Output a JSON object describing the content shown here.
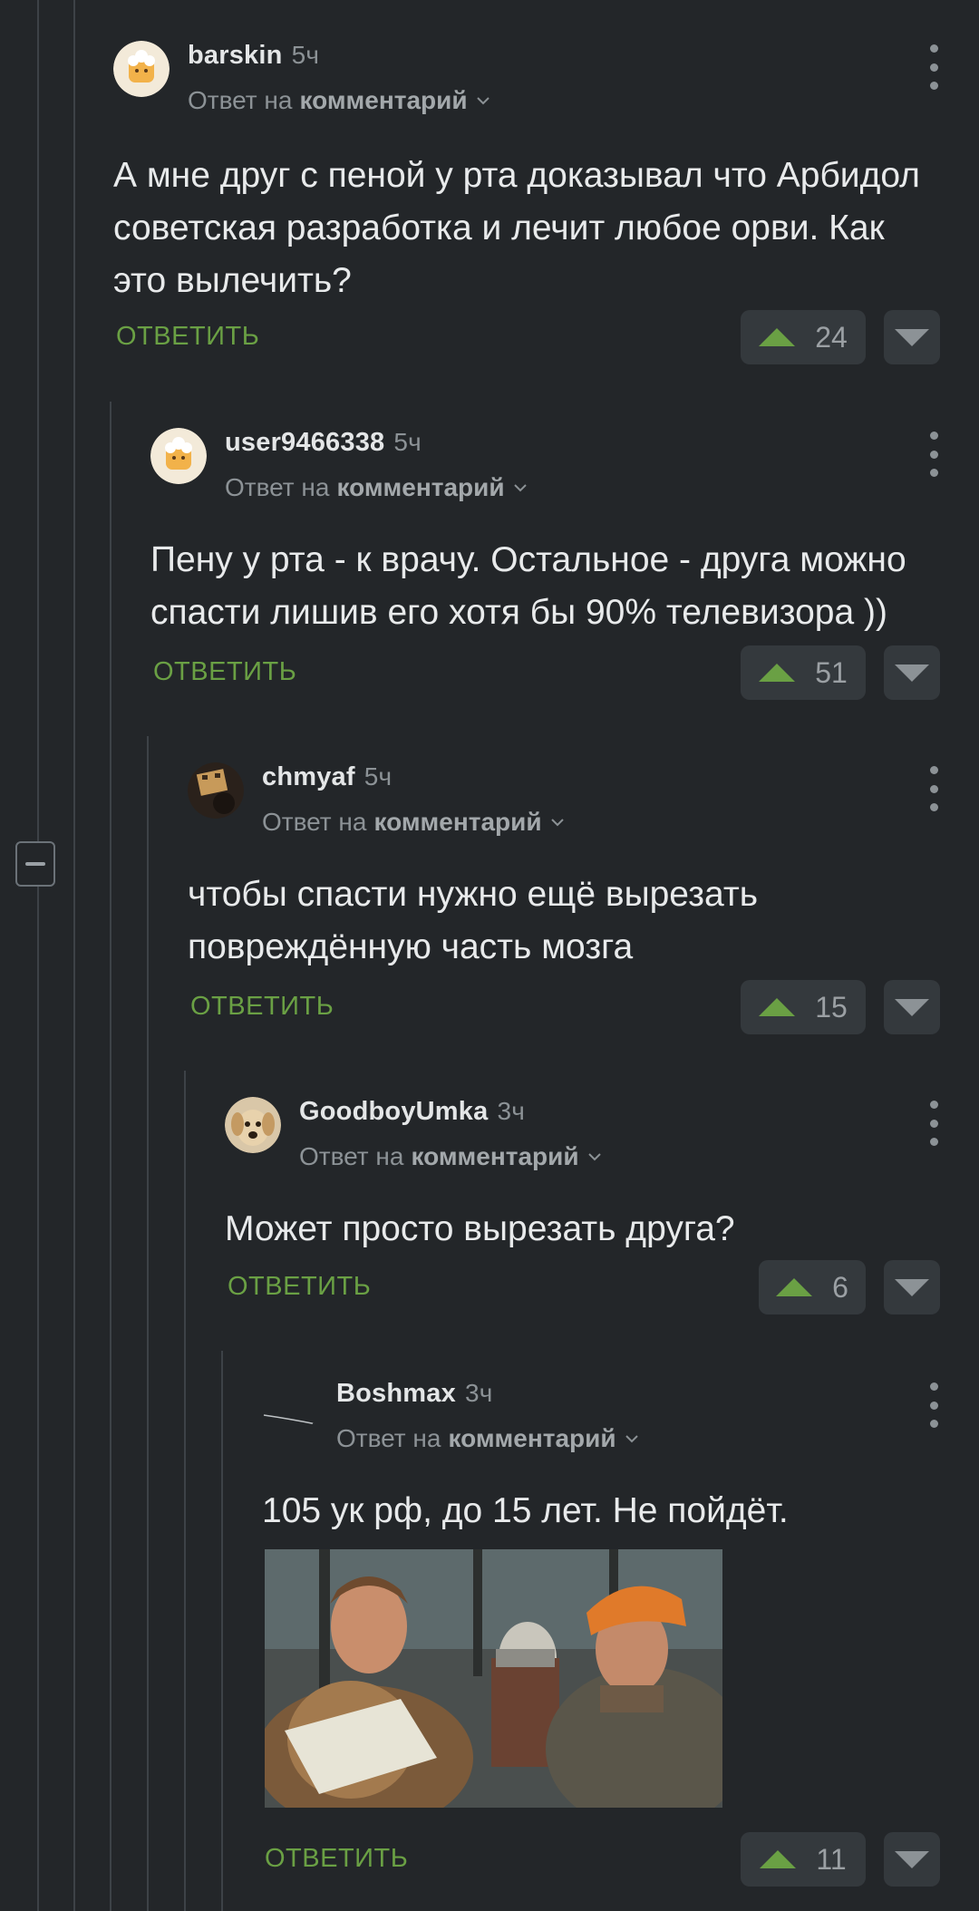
{
  "colors": {
    "background": "#232629",
    "accent_green": "#6aa044",
    "vote_bg": "#34393d"
  },
  "comments": [
    {
      "username": "barskin",
      "time": "5ч",
      "reply_prefix": "Ответ на",
      "reply_target": "комментарий",
      "text": "А мне друг с пеной у рта доказывал что Арбидол советская разработка и лечит любое орви. Как это вылечить?",
      "reply_label": "ОТВЕТИТЬ",
      "rating": "24"
    },
    {
      "username": "user9466338",
      "time": "5ч",
      "reply_prefix": "Ответ на",
      "reply_target": "комментарий",
      "text": "Пену у рта - к врачу. Остальное - друга можно спасти лишив его хотя бы 90% телевизора ))",
      "reply_label": "ОТВЕТИТЬ",
      "rating": "51"
    },
    {
      "username": "chmyaf",
      "time": "5ч",
      "reply_prefix": "Ответ на",
      "reply_target": "комментарий",
      "text": "чтобы спасти нужно ещё вырезать повреждённую часть мозга",
      "reply_label": "ОТВЕТИТЬ",
      "rating": "15"
    },
    {
      "username": "GoodboyUmka",
      "time": "3ч",
      "reply_prefix": "Ответ на",
      "reply_target": "комментарий",
      "text": "Может просто вырезать друга?",
      "reply_label": "ОТВЕТИТЬ",
      "rating": "6"
    },
    {
      "username": "Boshmax",
      "time": "3ч",
      "reply_prefix": "Ответ на",
      "reply_target": "комментарий",
      "text": "105 ук рф, до 15 лет. Не пойдёт.",
      "reply_label": "ОТВЕТИТЬ",
      "rating": "11"
    }
  ],
  "icons": [
    "collapse-thread-icon",
    "more-vertical-icon",
    "chevron-down-icon",
    "upvote-arrow-icon",
    "downvote-arrow-icon"
  ]
}
